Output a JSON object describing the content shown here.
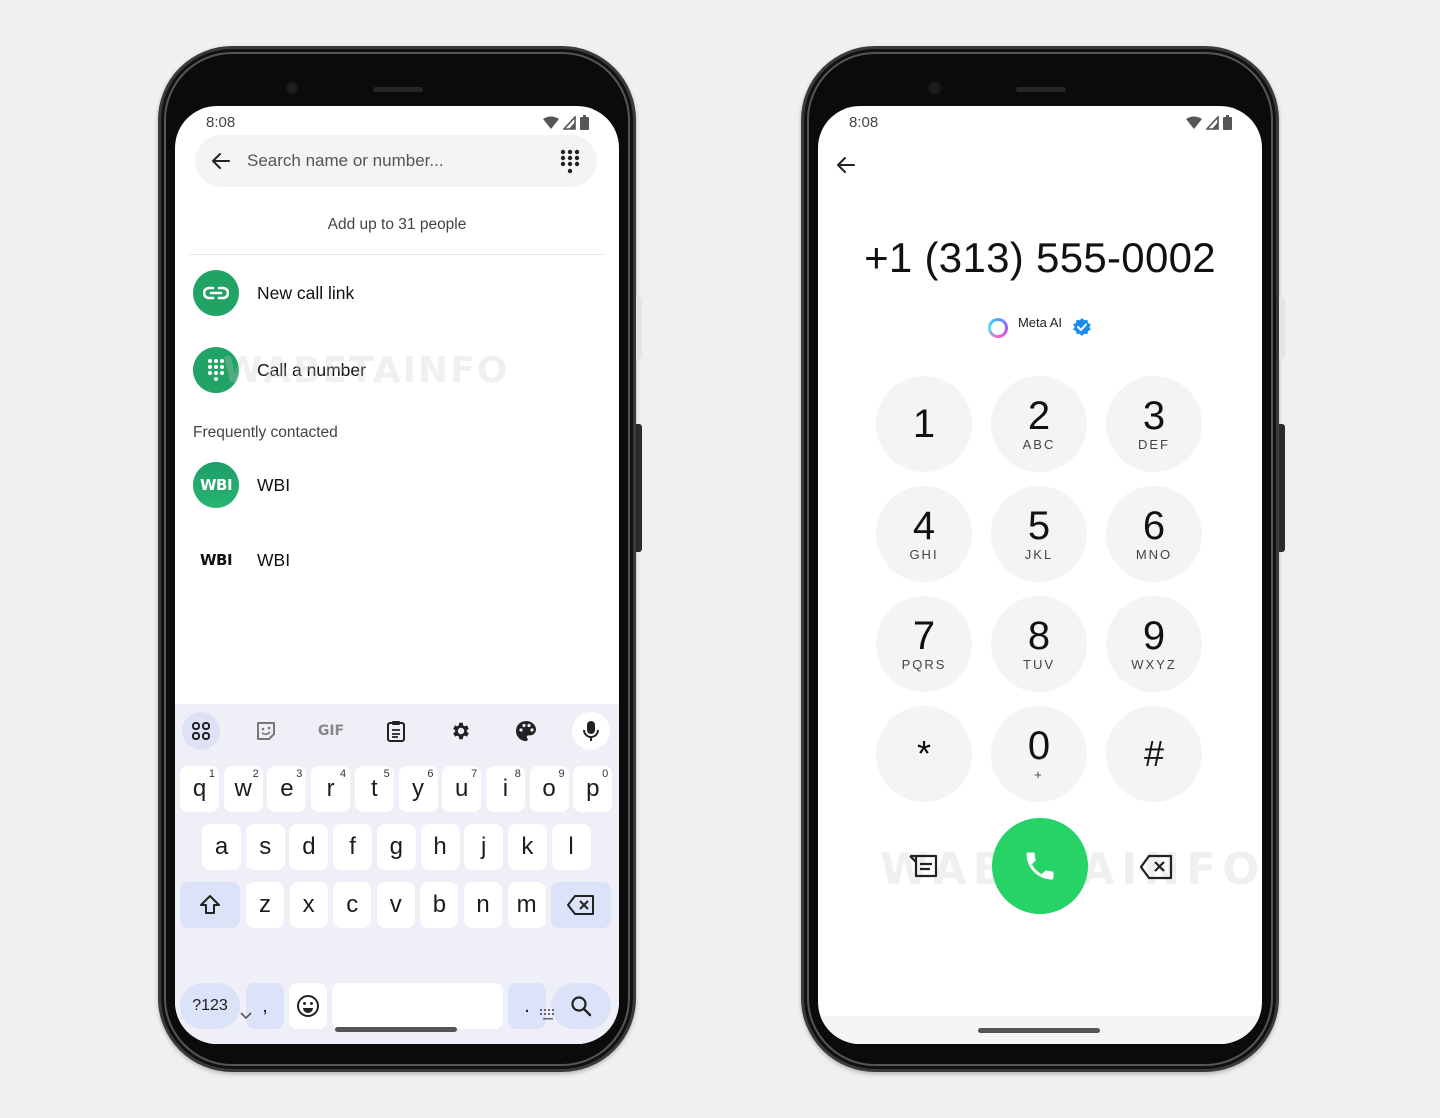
{
  "left_phone": {
    "status": {
      "time": "8:08"
    },
    "search": {
      "placeholder": "Search name or number..."
    },
    "hint": "Add up to 31 people",
    "actions": [
      {
        "label": "New call link",
        "icon": "link-icon"
      },
      {
        "label": "Call a number",
        "icon": "dialpad-icon"
      }
    ],
    "section_label": "Frequently contacted",
    "contacts": [
      {
        "name": "WBI",
        "avatar_text": "WBI",
        "avatar_style": "green"
      },
      {
        "name": "WBI",
        "avatar_text": "WBI",
        "avatar_style": "plain"
      }
    ],
    "watermark": "WABETAINFO",
    "keyboard": {
      "toolbar": [
        "apps-grid-icon",
        "sticker-icon",
        "gif-icon",
        "clipboard-icon",
        "gear-icon",
        "palette-icon",
        "mic-icon"
      ],
      "gif_label": "GIF",
      "row1": [
        {
          "k": "q",
          "h": "1"
        },
        {
          "k": "w",
          "h": "2"
        },
        {
          "k": "e",
          "h": "3"
        },
        {
          "k": "r",
          "h": "4"
        },
        {
          "k": "t",
          "h": "5"
        },
        {
          "k": "y",
          "h": "6"
        },
        {
          "k": "u",
          "h": "7"
        },
        {
          "k": "i",
          "h": "8"
        },
        {
          "k": "o",
          "h": "9"
        },
        {
          "k": "p",
          "h": "0"
        }
      ],
      "row2": [
        "a",
        "s",
        "d",
        "f",
        "g",
        "h",
        "j",
        "k",
        "l"
      ],
      "row3": [
        "z",
        "x",
        "c",
        "v",
        "b",
        "n",
        "m"
      ],
      "symbols_label": "?123",
      "comma": ",",
      "period": "."
    }
  },
  "right_phone": {
    "status": {
      "time": "8:08"
    },
    "number": "+1 (313) 555-0002",
    "contact_label": "Meta AI",
    "verified": true,
    "keys": [
      {
        "d": "1",
        "l": ""
      },
      {
        "d": "2",
        "l": "ABC"
      },
      {
        "d": "3",
        "l": "DEF"
      },
      {
        "d": "4",
        "l": "GHI"
      },
      {
        "d": "5",
        "l": "JKL"
      },
      {
        "d": "6",
        "l": "MNO"
      },
      {
        "d": "7",
        "l": "PQRS"
      },
      {
        "d": "8",
        "l": "TUV"
      },
      {
        "d": "9",
        "l": "WXYZ"
      },
      {
        "d": "*",
        "l": ""
      },
      {
        "d": "0",
        "l": "+"
      },
      {
        "d": "#",
        "l": ""
      }
    ],
    "watermark": "WABETAINFO",
    "colors": {
      "call_button": "#27d366"
    }
  },
  "colors": {
    "accent_green": "#21a366",
    "keyboard_bg": "#eff0f7",
    "keyboard_mod": "#dce2f7"
  }
}
